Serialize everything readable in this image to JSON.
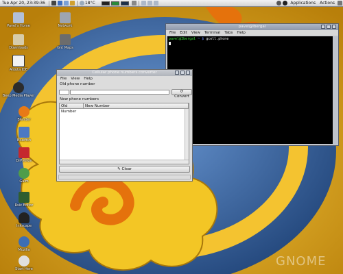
{
  "panel": {
    "clock": "Tue Apr 20, 23:39:36",
    "temperature": "18°C",
    "menus": [
      "Applications",
      "Actions"
    ]
  },
  "desktop": {
    "icons": [
      {
        "label": "Pavel's Home",
        "icon": "home-folder-icon"
      },
      {
        "label": "Downloads",
        "icon": "folder-icon"
      },
      {
        "label": "Anjuta IDE",
        "icon": "anjuta-icon"
      },
      {
        "label": "Beep Media Player",
        "icon": "media-player-icon"
      },
      {
        "label": "Blender",
        "icon": "blender-icon"
      },
      {
        "label": "Bluefish",
        "icon": "bluefish-icon"
      },
      {
        "label": "DrPython",
        "icon": "drpython-icon"
      },
      {
        "label": "Gaim",
        "icon": "gaim-icon"
      },
      {
        "label": "Rsix Editor",
        "icon": "editor-icon"
      },
      {
        "label": "Inkscape",
        "icon": "inkscape-icon"
      },
      {
        "label": "Mozilla",
        "icon": "globe-icon"
      },
      {
        "label": "Start Here",
        "icon": "start-here-icon"
      }
    ],
    "right_icons": [
      {
        "label": "Network",
        "icon": "network-icon"
      },
      {
        "label": "Gnt Maps",
        "icon": "maps-icon"
      }
    ],
    "watermark": "GNOME"
  },
  "terminal": {
    "title": "pavel@Ibergal",
    "menu": [
      "File",
      "Edit",
      "View",
      "Terminal",
      "Tabs",
      "Help"
    ],
    "prompt_user": "pavel@Ibergal",
    "prompt_path": "~",
    "prompt_symbol": "$",
    "command": "gcell.phone"
  },
  "app": {
    "title": "Cellular phone numbers converter",
    "menu": [
      "File",
      "View",
      "Help"
    ],
    "old_label": "Old phone number",
    "convert_label": "Convert",
    "new_label": "New phone numbers",
    "columns": [
      "Old Number",
      "New Number"
    ],
    "rows": [],
    "clear_label": "Clear"
  },
  "colors": {
    "wallpaper_yellow": "#e2aa16",
    "wallpaper_blue": "#3e6aa6",
    "terminal_bg": "#000000",
    "prompt_green": "#3de23d"
  }
}
